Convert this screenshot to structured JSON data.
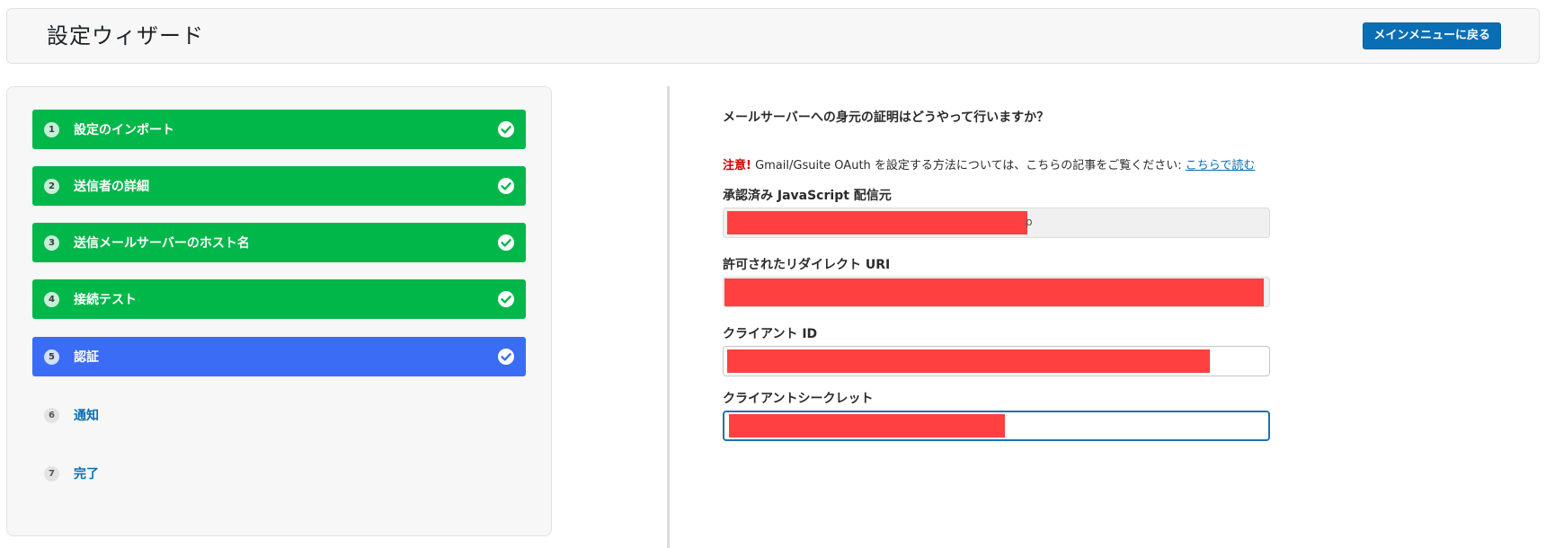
{
  "header": {
    "title": "設定ウィザード",
    "main_menu_button": "メインメニューに戻る"
  },
  "steps": [
    {
      "number": "1",
      "label": "設定のインポート",
      "state": "done"
    },
    {
      "number": "2",
      "label": "送信者の詳細",
      "state": "done"
    },
    {
      "number": "3",
      "label": "送信メールサーバーのホスト名",
      "state": "done"
    },
    {
      "number": "4",
      "label": "接続テスト",
      "state": "done"
    },
    {
      "number": "5",
      "label": "認証",
      "state": "current"
    },
    {
      "number": "6",
      "label": "通知",
      "state": "pending"
    },
    {
      "number": "7",
      "label": "完了",
      "state": "pending"
    }
  ],
  "form": {
    "question": "メールサーバーへの身元の証明はどうやって行いますか？",
    "note_label": "注意!",
    "note_text": " Gmail/Gsuite OAuth を設定する方法については、こちらの記事をご覧ください: ",
    "note_link": "こちらで読む",
    "fields": [
      {
        "label": "承認済み JavaScript 配信元",
        "value_tail": "p"
      },
      {
        "label": "許可されたリダイレクト URI"
      },
      {
        "label": "クライアント ID"
      },
      {
        "label": "クライアントシークレット"
      }
    ]
  },
  "colors": {
    "done": "#02b74a",
    "current": "#3a6cf5",
    "pending_link": "#0a6eb4",
    "primary_button": "#0a6eb4",
    "note_red": "#d40000",
    "redaction": "#ff4040"
  },
  "icons": {
    "step_complete": "check-circle-icon"
  }
}
